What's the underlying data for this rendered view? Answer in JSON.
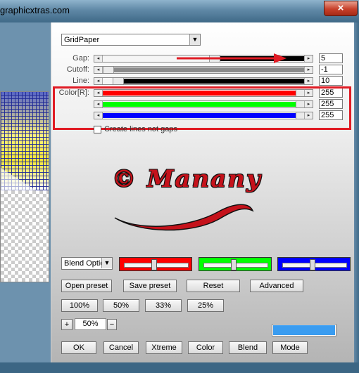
{
  "window": {
    "title_fragment": "graphicxtras.com",
    "close_glyph": "×"
  },
  "preset_select": {
    "value": "GridPaper",
    "arrow": "▼"
  },
  "sliders": [
    {
      "id": "gap",
      "label": "Gap:",
      "value": "5",
      "level": 0.55,
      "track_color": "#000000"
    },
    {
      "id": "cutoff",
      "label": "Cutoff:",
      "value": "-1",
      "level": 0.0,
      "track_color": "#8a8a8a"
    },
    {
      "id": "line",
      "label": "Line:",
      "value": "10",
      "level": 0.05,
      "track_color": "#000000"
    },
    {
      "id": "red",
      "label": "Color[R]:",
      "value": "255",
      "level": 1.0,
      "track_color": "#ff0000"
    },
    {
      "id": "green",
      "label": "",
      "value": "255",
      "level": 1.0,
      "track_color": "#00ff00"
    },
    {
      "id": "blue",
      "label": "",
      "value": "255",
      "level": 1.0,
      "track_color": "#0000ff"
    }
  ],
  "checkbox": {
    "label": "Create lines not gaps",
    "checked": false
  },
  "watermark": {
    "text": "© Manany"
  },
  "blend_select": {
    "value": "Blend Optio",
    "arrow": "▼"
  },
  "channel_swatches": [
    {
      "color": "#ff0000",
      "level": 0.45
    },
    {
      "color": "#00ff00",
      "level": 0.45
    },
    {
      "color": "#0000ff",
      "level": 0.45
    }
  ],
  "buttons": {
    "open_preset": "Open preset",
    "save_preset": "Save preset",
    "reset": "Reset",
    "advanced": "Advanced",
    "zoom_100": "100%",
    "zoom_50": "50%",
    "zoom_33": "33%",
    "zoom_25": "25%",
    "zoom_plus": "+",
    "zoom_minus": "−",
    "ok": "OK",
    "cancel": "Cancel",
    "xtreme": "Xtreme",
    "color": "Color",
    "blend": "Blend",
    "mode": "Mode"
  },
  "zoom_value": "50%",
  "color_preview": "#3a9cf0",
  "annotations": {
    "highlight_color": "#e01b24"
  }
}
